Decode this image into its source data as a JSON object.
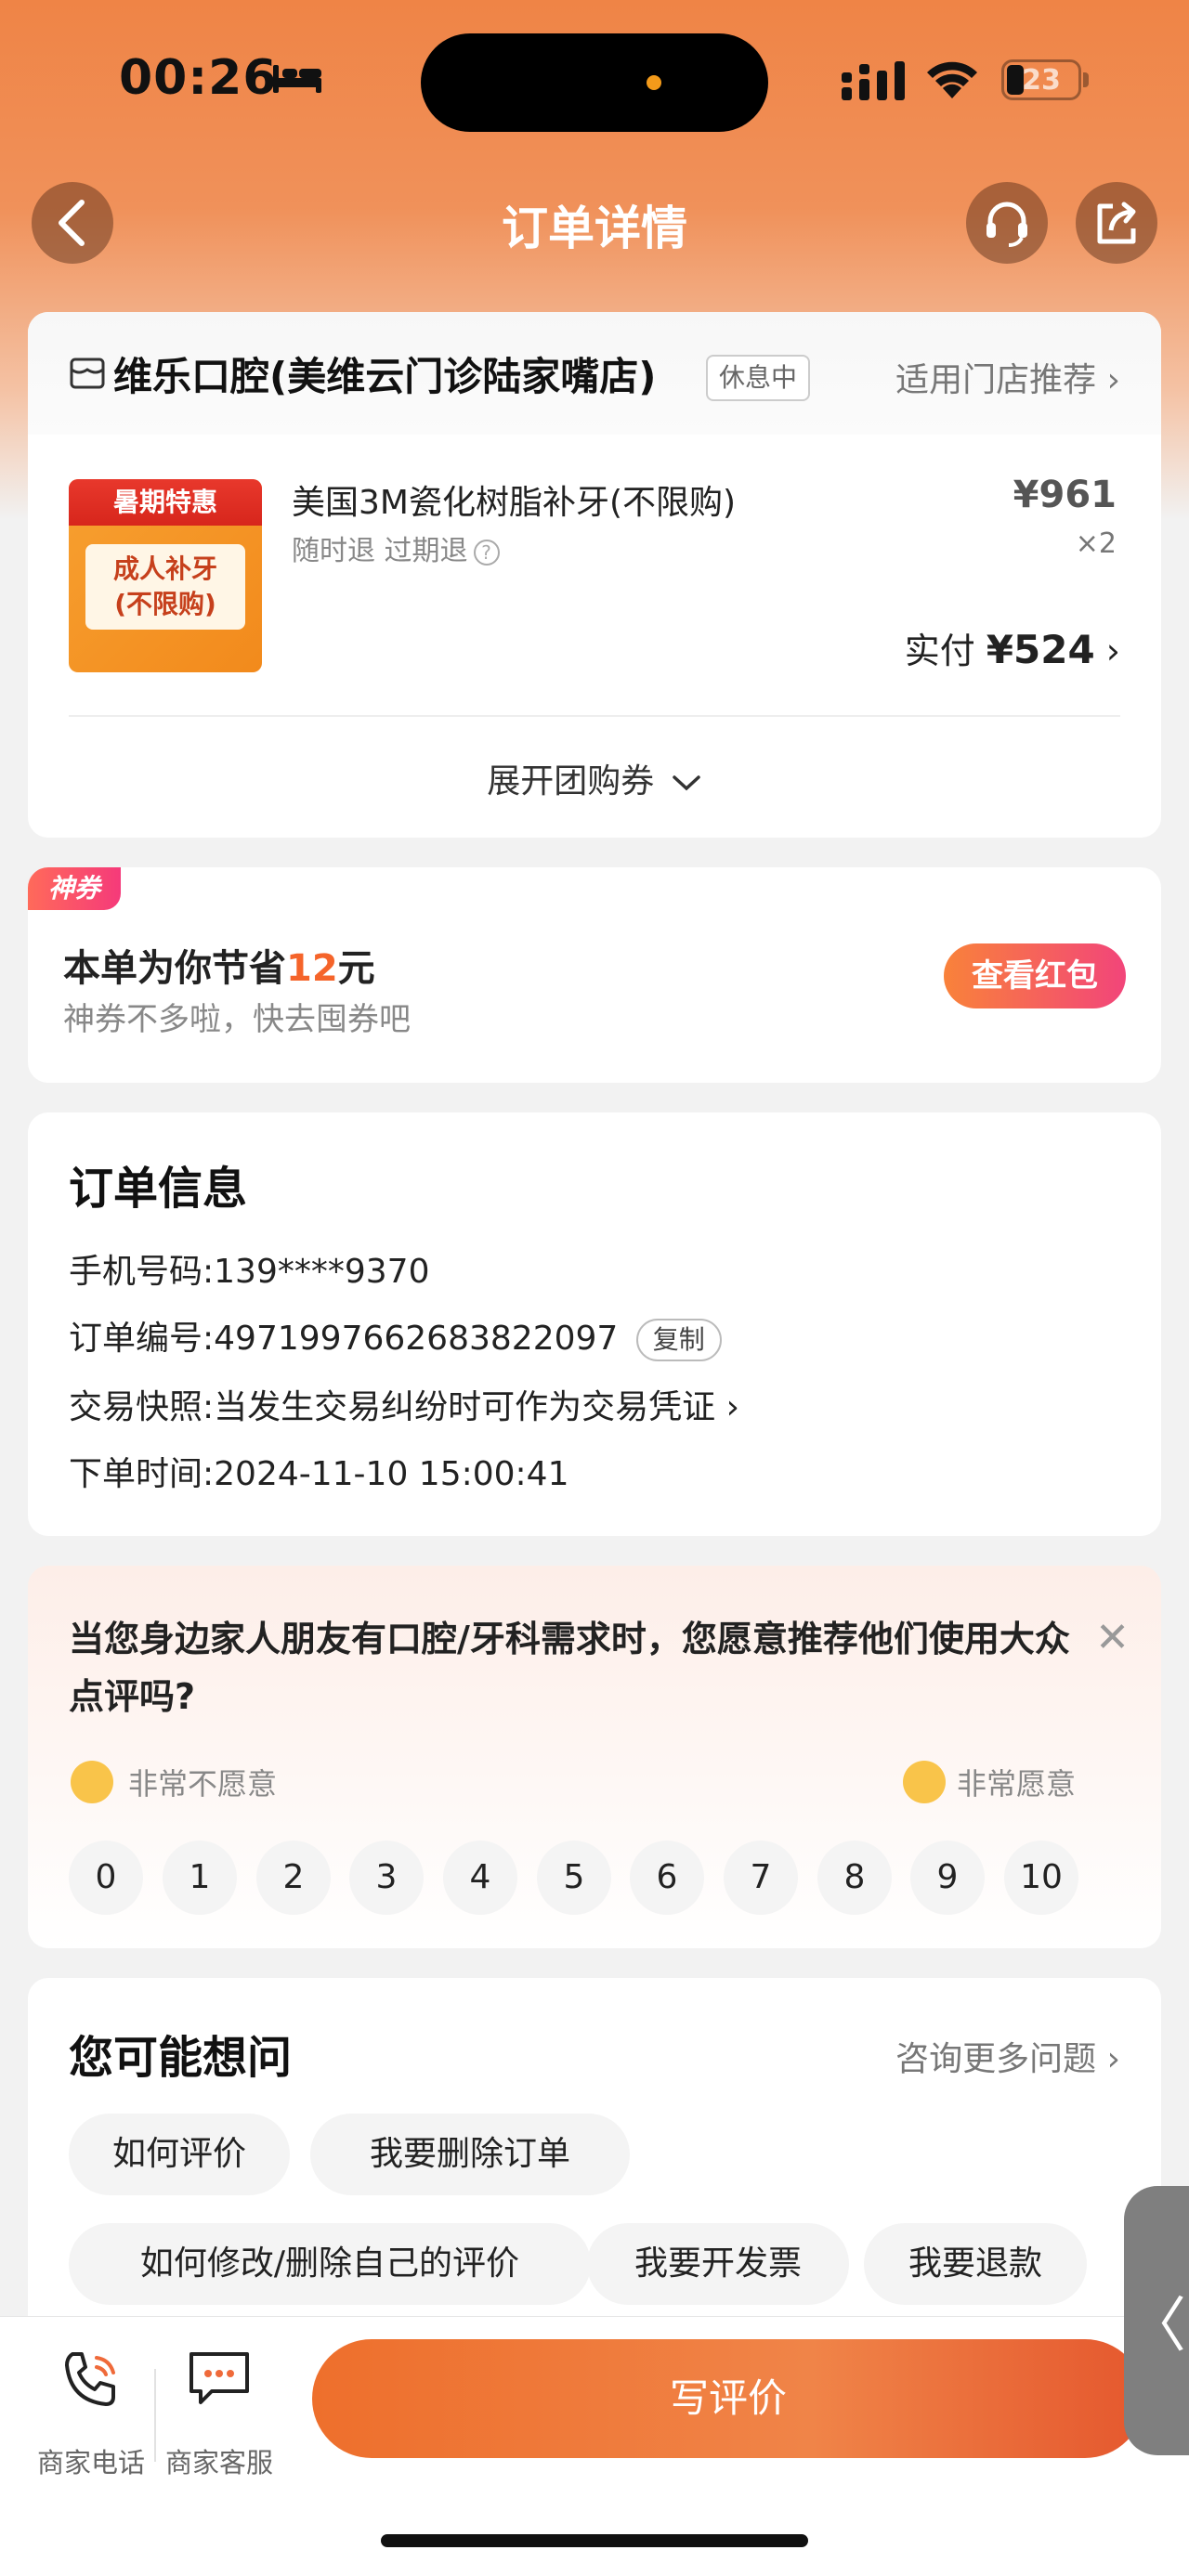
{
  "status_bar": {
    "time": "00:26",
    "battery": "23"
  },
  "nav": {
    "title": "订单详情"
  },
  "shop": {
    "name": "维乐口腔(美维云门诊陆家嘴店)",
    "status": "休息中",
    "store_recommend": "适用门店推荐",
    "product": {
      "thumb_tag": "暑期特惠",
      "thumb_label_line1": "成人补牙",
      "thumb_label_line2": "(不限购)",
      "title": "美国3M瓷化树脂补牙(不限购)",
      "tags": "随时退 过期退",
      "price": "¥961",
      "quantity": "×2",
      "paid_label": "实付",
      "paid_amount": "¥524"
    },
    "expand_label": "展开团购券"
  },
  "coupon": {
    "tag": "神券",
    "title_prefix": "本单为你节省",
    "amount": "12",
    "title_suffix": "元",
    "subtitle": "神券不多啦，快去囤券吧",
    "button": "查看红包"
  },
  "order_info": {
    "title": "订单信息",
    "phone_label": "手机号码:",
    "phone": "139****9370",
    "order_no_label": "订单编号:",
    "order_no": "4971997662683822097",
    "copy": "复制",
    "snapshot_label": "交易快照:",
    "snapshot": "当发生交易纠纷时可作为交易凭证",
    "time_label": "下单时间:",
    "time": "2024-11-10 15:00:41"
  },
  "survey": {
    "question": "当您身边家人朋友有口腔/牙科需求时，您愿意推荐他们使用大众点评吗?",
    "low_label": "非常不愿意",
    "high_label": "非常愿意",
    "scores": [
      "0",
      "1",
      "2",
      "3",
      "4",
      "5",
      "6",
      "7",
      "8",
      "9",
      "10"
    ]
  },
  "faq": {
    "title": "您可能想问",
    "more": "咨询更多问题",
    "chips": [
      "如何评价",
      "我要删除订单",
      "如何修改/删除自己的评价",
      "我要开发票",
      "我要退款"
    ]
  },
  "bottom": {
    "phone_label": "商家电话",
    "service_label": "商家客服",
    "write_review": "写评价",
    "side_tab": "〈"
  },
  "colors": {
    "accent": "#ef7a3a",
    "coupon_amount": "#f5642a"
  }
}
